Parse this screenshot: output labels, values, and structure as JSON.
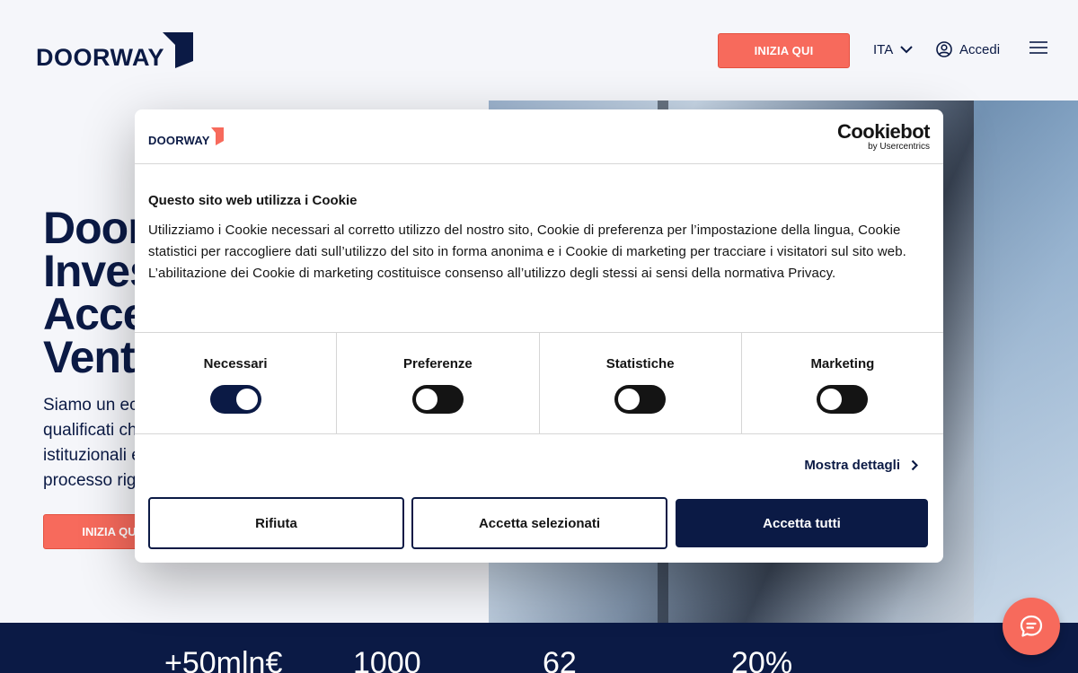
{
  "header": {
    "logo_text": "DOORWAY",
    "cta_label": "INIZIA QUI",
    "language": "ITA",
    "login_label": "Accedi"
  },
  "hero": {
    "title_lines": [
      "Door",
      "Inves",
      "Acce",
      "Vent"
    ],
    "text_lines": [
      "Siamo un ec",
      "qualificati ch",
      "istituzionali e",
      "processo rig"
    ],
    "cta_label": "INIZIA QU"
  },
  "stats": [
    "+50mln€",
    "1000",
    "62",
    "20%"
  ],
  "cookie": {
    "logo_text": "DOORWAY",
    "provider_name": "Cookiebot",
    "provider_sub": "by Usercentrics",
    "title": "Questo sito web utilizza i Cookie",
    "text": "Utilizziamo i Cookie necessari al corretto utilizzo del nostro sito, Cookie di preferenza per l’impostazione della lingua, Cookie statistici per raccogliere dati sull’utilizzo del sito in forma anonima e i Cookie di marketing per tracciare i visitatori sul sito web. L’abilitazione dei Cookie di marketing costituisce consenso all’utilizzo degli stessi ai sensi della normativa Privacy.",
    "categories": [
      {
        "label": "Necessari",
        "enabled": true
      },
      {
        "label": "Preferenze",
        "enabled": false
      },
      {
        "label": "Statistiche",
        "enabled": false
      },
      {
        "label": "Marketing",
        "enabled": false
      }
    ],
    "details_label": "Mostra dettagli",
    "reject_label": "Rifiuta",
    "accept_selected_label": "Accetta selezionati",
    "accept_all_label": "Accetta tutti"
  },
  "colors": {
    "navy": "#0b1a45",
    "coral": "#f76a5c"
  }
}
